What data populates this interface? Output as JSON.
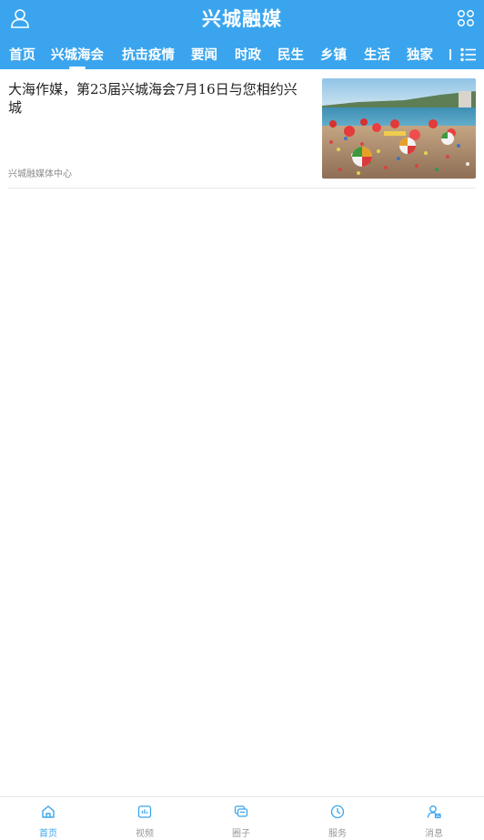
{
  "header": {
    "brand": "兴城融媒",
    "bg_color": "#3aa5ee"
  },
  "tabs": [
    {
      "label": "首页",
      "active": false
    },
    {
      "label": "兴城海会",
      "active": true
    },
    {
      "label": "抗击疫情",
      "active": false
    },
    {
      "label": "要闻",
      "active": false
    },
    {
      "label": "时政",
      "active": false
    },
    {
      "label": "民生",
      "active": false
    },
    {
      "label": "乡镇",
      "active": false
    },
    {
      "label": "生活",
      "active": false
    },
    {
      "label": "独家",
      "active": false
    }
  ],
  "articles": [
    {
      "title": "大海作媒，第23届兴城海会7月16日与您相约兴城",
      "source": "兴城融媒体中心",
      "thumbnail": "beach-festival-photo"
    }
  ],
  "bottom_nav": [
    {
      "label": "首页",
      "icon": "home-icon",
      "active": true
    },
    {
      "label": "视频",
      "icon": "video-icon",
      "active": false
    },
    {
      "label": "圈子",
      "icon": "chat-icon",
      "active": false
    },
    {
      "label": "服务",
      "icon": "clock-icon",
      "active": false
    },
    {
      "label": "消息",
      "icon": "message-user-icon",
      "active": false
    }
  ],
  "colors": {
    "accent": "#3aa5ee",
    "inactive": "#999999"
  }
}
